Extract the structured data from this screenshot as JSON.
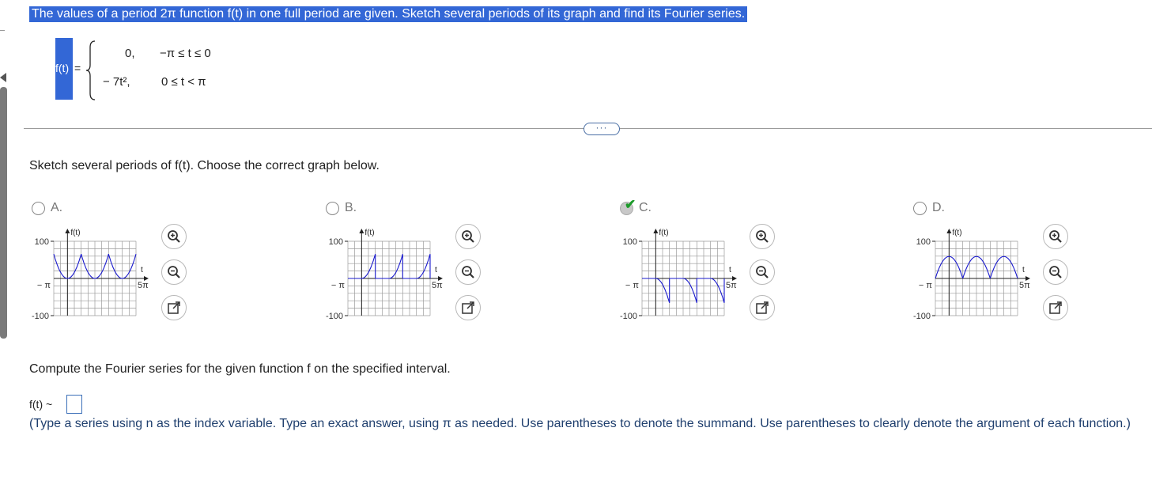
{
  "question": "The values of a period 2π function f(t) in one full period are given. Sketch several periods of its graph and find its Fourier series.",
  "definition": {
    "lhs": "f(t)",
    "eq": "=",
    "cases": [
      {
        "value": "0,",
        "condition": "−π ≤ t ≤ 0"
      },
      {
        "value": "− 7t², ",
        "condition": "0 ≤ t < π"
      }
    ]
  },
  "divider_button": "···",
  "sketch_prompt": "Sketch several periods of f(t). Choose the correct graph below.",
  "options": [
    {
      "label": "A.",
      "selected": false,
      "shape": "cup-shaped arcs from 0 down to about -69 (positive-looking bowls drawn above axis)"
    },
    {
      "label": "B.",
      "selected": false,
      "shape": "rising curves from 0 up to about 69 then drop"
    },
    {
      "label": "C.",
      "selected": true,
      "shape": "zero, then drops to about -69 curve below axis"
    },
    {
      "label": "D.",
      "selected": false,
      "shape": "arches above axis"
    }
  ],
  "graph": {
    "ylabel": "f(t)",
    "xlabel": "t",
    "ymax_label": "100",
    "ymin_label": "-100",
    "xmin_label": "− π",
    "xmax_label": "5π",
    "ylim": [
      -100,
      100
    ],
    "xlim_periods": [
      -1,
      5
    ]
  },
  "icons": {
    "zoom_in": "zoom-in-icon",
    "zoom_out": "zoom-out-icon",
    "open_new": "open-new-window-icon"
  },
  "compute_prompt": "Compute the Fourier series for the given function f on the specified interval.",
  "answer_label": "f(t) ~",
  "hint": "(Type a series using n as the index variable. Type an exact answer, using π as needed. Use parentheses to denote the summand. Use parentheses to clearly denote the argument of each function.)",
  "colors": {
    "highlight": "#3367d6",
    "curve": "#1a1acd",
    "hint_text": "#1f3f6e",
    "check": "#1c9a2a"
  }
}
